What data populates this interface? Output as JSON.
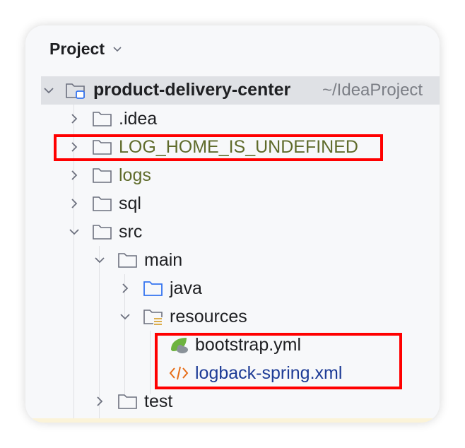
{
  "panel": {
    "title": "Project",
    "title_dropdown_icon": "chevron-down-icon"
  },
  "tree": {
    "root": {
      "name": "product-delivery-center",
      "path": "~/IdeaProject",
      "expanded": true,
      "icon": "module-folder-icon"
    },
    "items": [
      {
        "label": ".idea",
        "expanded": false,
        "icon": "folder-icon"
      },
      {
        "label": "LOG_HOME_IS_UNDEFINED",
        "expanded": false,
        "icon": "folder-icon"
      },
      {
        "label": "logs",
        "expanded": false,
        "icon": "folder-icon"
      },
      {
        "label": "sql",
        "expanded": false,
        "icon": "folder-icon"
      },
      {
        "label": "src",
        "expanded": true,
        "icon": "folder-icon"
      },
      {
        "label": "main",
        "expanded": true,
        "icon": "folder-icon"
      },
      {
        "label": "java",
        "expanded": false,
        "icon": "source-folder-icon"
      },
      {
        "label": "resources",
        "expanded": true,
        "icon": "resources-folder-icon"
      },
      {
        "label": "bootstrap.yml",
        "icon": "spring-yaml-icon"
      },
      {
        "label": "logback-spring.xml",
        "icon": "xml-file-icon"
      },
      {
        "label": "test",
        "expanded": false,
        "icon": "folder-icon"
      }
    ]
  },
  "colors": {
    "highlight": "#ff0000",
    "selection": "#dfe1e5",
    "excluded_text": "#5f6b2b",
    "xml_text": "#1d3b96",
    "source_folder": "#3574f0"
  }
}
